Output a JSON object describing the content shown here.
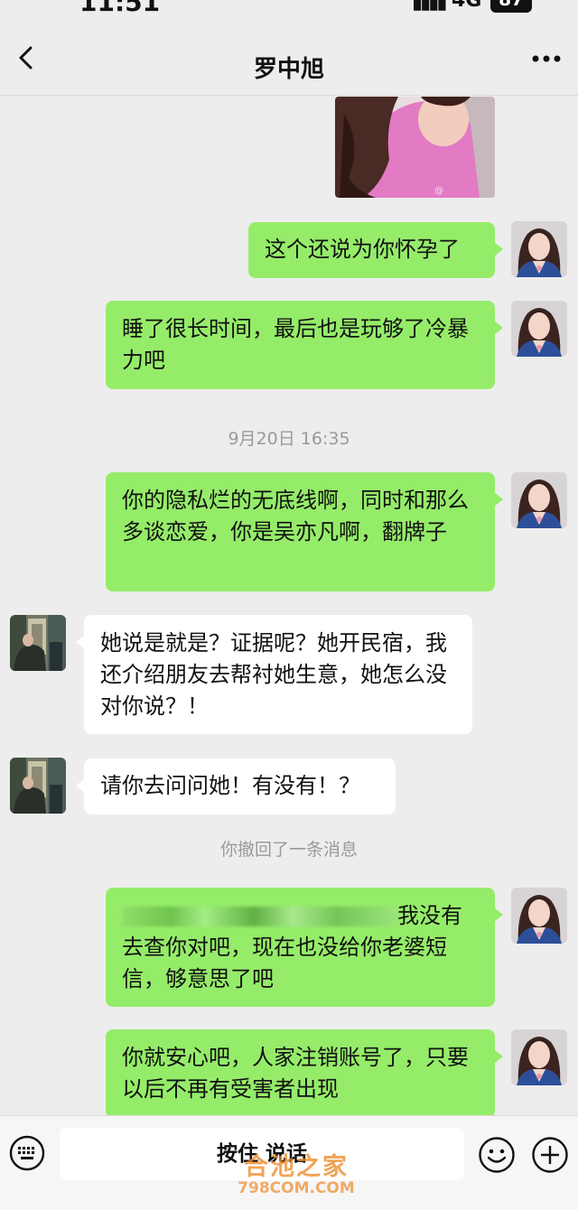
{
  "status_bar": {
    "time": "11:51",
    "signal": "▮▮▮▮",
    "network": "4G",
    "battery": "87"
  },
  "header": {
    "title": "罗中旭"
  },
  "messages": [
    {
      "side": "right",
      "text": "这个还说为你怀孕了"
    },
    {
      "side": "right",
      "text": "睡了很长时间，最后也是玩够了冷暴力吧"
    },
    {
      "side": "right",
      "text": "你的隐私烂的无底线啊，同时和那么多谈恋爱，你是吴亦凡啊，翻牌子"
    },
    {
      "side": "left",
      "text": "她说是就是？证据呢？她开民宿，我还介绍朋友去帮衬她生意，她怎么没对你说？！"
    },
    {
      "side": "left",
      "text": "请你去问问她！有没有！？"
    },
    {
      "side": "right",
      "text_visible": "我没有去查你对吧，现在也没给你老婆短信，够意思了吧"
    },
    {
      "side": "right",
      "text": "你就安心吧，人家注销账号了，只要以后不再有受害者出现"
    }
  ],
  "timestamps": {
    "t1": "9月20日 16:35"
  },
  "system": {
    "recalled": "你撤回了一条消息"
  },
  "input_bar": {
    "voice_label": "按住 说话"
  },
  "watermark": {
    "text": "合池之家",
    "url": "798COM.COM"
  },
  "colors": {
    "bubble_self": "#95ec69",
    "bubble_other": "#ffffff",
    "background": "#ededed"
  }
}
